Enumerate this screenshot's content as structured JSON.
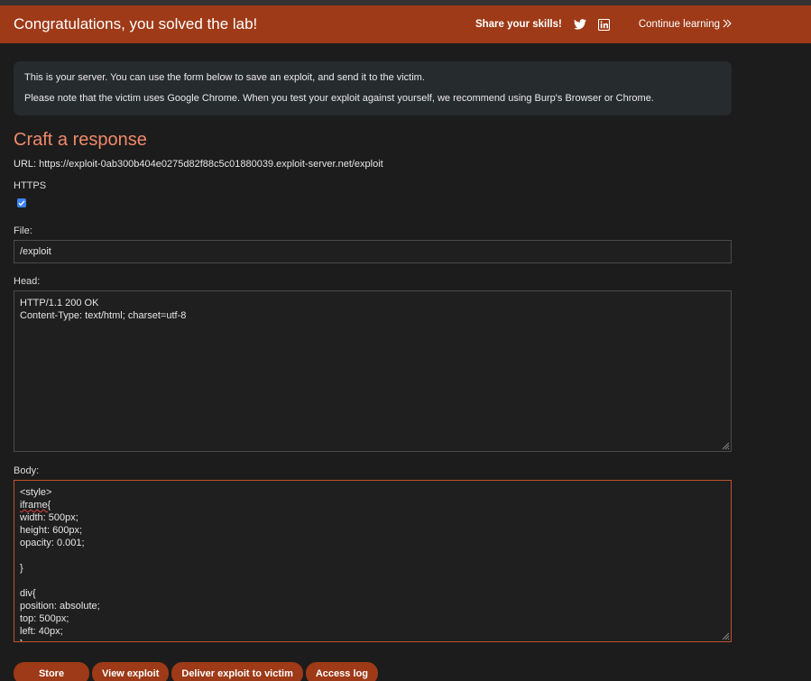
{
  "banner": {
    "title": "Congratulations, you solved the lab!",
    "share_label": "Share your skills!",
    "twitter_icon": "twitter-icon",
    "linkedin_icon": "linkedin-icon",
    "continue_label": "Continue learning",
    "continue_icon": "double-chevron-right-icon",
    "color": "#9e3a17"
  },
  "info": {
    "line1": "This is your server. You can use the form below to save an exploit, and send it to the victim.",
    "line2": "Please note that the victim uses Google Chrome. When you test your exploit against yourself, we recommend using Burp's Browser or Chrome."
  },
  "form": {
    "heading": "Craft a response",
    "url_text": "URL: https://exploit-0ab300b404e0275d82f88c5c01880039.exploit-server.net/exploit",
    "https_label": "HTTPS",
    "https_checked": true,
    "file_label": "File:",
    "file_value": "/exploit",
    "head_label": "Head:",
    "head_lines": [
      "HTTP/1.1 200 OK",
      "Content-Type: text/html; charset=utf-8"
    ],
    "body_label": "Body:",
    "body_lines": [
      "<style>",
      "iframe{",
      "width: 500px;",
      "height: 600px;",
      "opacity: 0.001;",
      "",
      "}",
      "",
      "div{",
      "position: absolute;",
      "top: 500px;",
      "left: 40px;",
      "}"
    ]
  },
  "buttons": {
    "store": "Store",
    "view": "View exploit",
    "deliver": "Deliver exploit to victim",
    "log": "Access log"
  }
}
